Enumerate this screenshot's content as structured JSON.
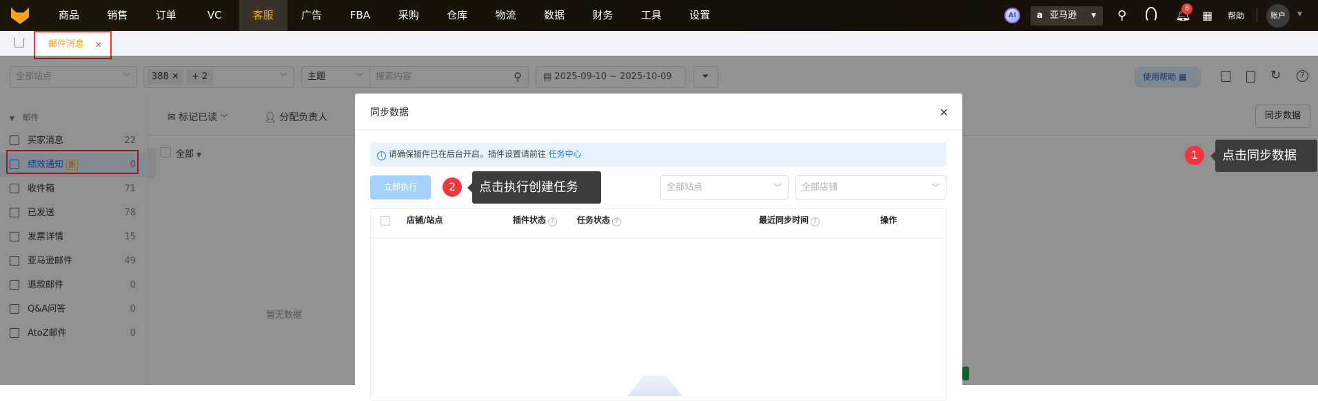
{
  "topnav": {
    "items": [
      "商品",
      "销售",
      "订单",
      "VC",
      "客服",
      "广告",
      "FBA",
      "采购",
      "仓库",
      "物流",
      "数据",
      "财务",
      "工具",
      "设置"
    ],
    "active": "客服",
    "ai_label": "AI",
    "platform": "亚马逊",
    "notification_count": "8",
    "help": "帮助",
    "account": "账户"
  },
  "tabs": {
    "active_tab": "邮件消息"
  },
  "filters": {
    "site_placeholder": "全部站点",
    "store_tag": "388",
    "store_more": "+ 2",
    "subject": "主题",
    "search_placeholder": "搜索内容",
    "date_range": "2025-09-10 ~ 2025-10-09",
    "help_button": "使用帮助"
  },
  "sidebar": {
    "group": "邮件",
    "items": [
      {
        "label": "买家消息",
        "count": "22"
      },
      {
        "label": "绩效通知",
        "count": "0",
        "badge": "新"
      },
      {
        "label": "收件箱",
        "count": "71"
      },
      {
        "label": "已发送",
        "count": "78"
      },
      {
        "label": "发票详情",
        "count": "15"
      },
      {
        "label": "亚马逊邮件",
        "count": "49"
      },
      {
        "label": "退款邮件",
        "count": "0"
      },
      {
        "label": "Q&A问答",
        "count": "0"
      },
      {
        "label": "AtoZ邮件",
        "count": "0"
      }
    ]
  },
  "content": {
    "mark_read": "标记已读",
    "assign": "分配负责人",
    "select_all": "全部",
    "empty": "暂无数据",
    "sync_button": "同步数据"
  },
  "modal": {
    "title": "同步数据",
    "notice": "请确保插件已在后台开启。插件设置请前往",
    "notice_link": "任务中心",
    "run_button": "立即执行",
    "site_placeholder": "全部站点",
    "store_placeholder": "全部店铺",
    "columns": [
      "店铺/站点",
      "插件状态",
      "任务状态",
      "最近同步时间",
      "操作"
    ]
  },
  "guides": [
    {
      "step": "1",
      "text": "点击同步数据"
    },
    {
      "step": "2",
      "text": "点击执行创建任务"
    }
  ],
  "colors": {
    "accent": "#f5a21c",
    "primary": "#1677ff",
    "danger": "#f2363a"
  }
}
